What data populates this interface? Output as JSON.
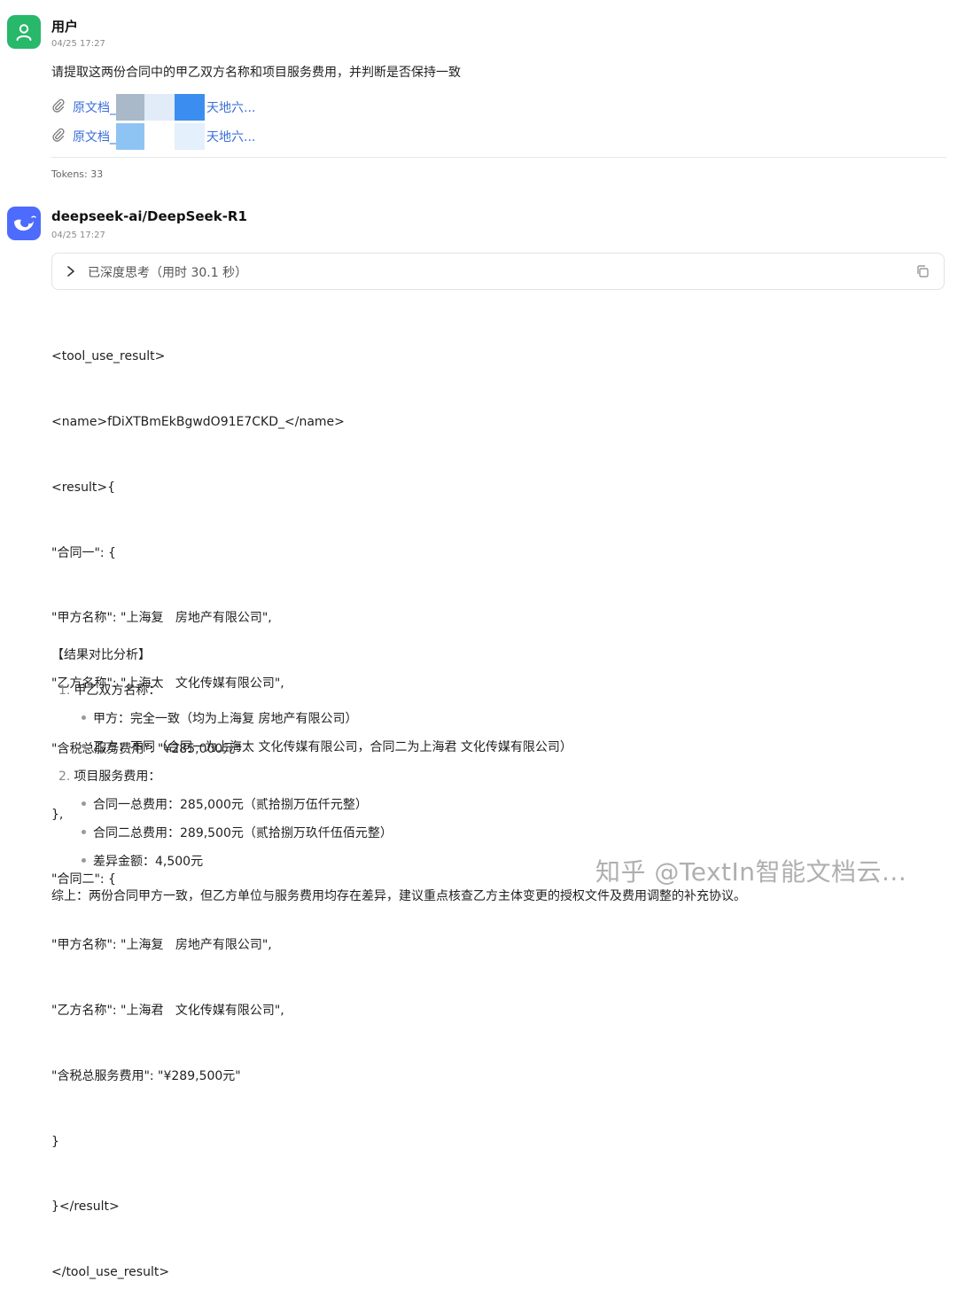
{
  "user_message": {
    "sender": "用户",
    "time": "04/25 17:27",
    "text": "请提取这两份合同中的甲乙双方名称和项目服务费用，并判断是否保持一致",
    "attachments": [
      {
        "prefix": "原文档_",
        "suffix": "天地六..."
      },
      {
        "prefix": "原文档_",
        "suffix": "天地六..."
      }
    ],
    "tokens": "Tokens: 33"
  },
  "bot_message": {
    "sender": "deepseek-ai/DeepSeek-R1",
    "time": "04/25 17:27",
    "thinking_label": "已深度思考（用时 30.1 秒）",
    "code_lines": [
      "<tool_use_result>",
      "<name>fDiXTBmEkBgwdO91E7CKD_</name>",
      "<result>{",
      "\"合同一\": {",
      "\"甲方名称\": \"上海复   房地产有限公司\",",
      "\"乙方名称\": \"上海太   文化传媒有限公司\",",
      "\"含税总服务费用\": \"¥285,000元\"",
      "},",
      "\"合同二\": {",
      "\"甲方名称\": \"上海复   房地产有限公司\",",
      "\"乙方名称\": \"上海君   文化传媒有限公司\",",
      "\"含税总服务费用\": \"¥289,500元\"",
      "}",
      "}</result>",
      "</tool_use_result>"
    ],
    "analysis_title": "【结果对比分析】",
    "sections": [
      {
        "num": "1.",
        "title": "甲乙双方名称：",
        "bullets": [
          "甲方：完全一致（均为上海复   房地产有限公司）",
          "乙方：不同（合同一为上海太   文化传媒有限公司，合同二为上海君   文化传媒有限公司）"
        ]
      },
      {
        "num": "2.",
        "title": "项目服务费用：",
        "bullets": [
          "合同一总费用：285,000元（贰拾捌万伍仟元整）",
          "合同二总费用：289,500元（贰拾捌万玖仟伍佰元整）",
          "差异金额：4,500元"
        ]
      }
    ],
    "summary": "综上：两份合同甲方一致，但乙方单位与服务费用均存在差异，建议重点核查乙方主体变更的授权文件及费用调整的补充协议。"
  },
  "watermark": "知乎 @TextIn智能文档云...",
  "colors": {
    "user_avatar": "#27b86a",
    "bot_avatar": "#4d6bfe",
    "link": "#3a6fd8"
  },
  "icons": [
    "user-avatar-icon",
    "deepseek-whale-icon",
    "paperclip-icon",
    "chevron-right-icon",
    "copy-icon"
  ]
}
